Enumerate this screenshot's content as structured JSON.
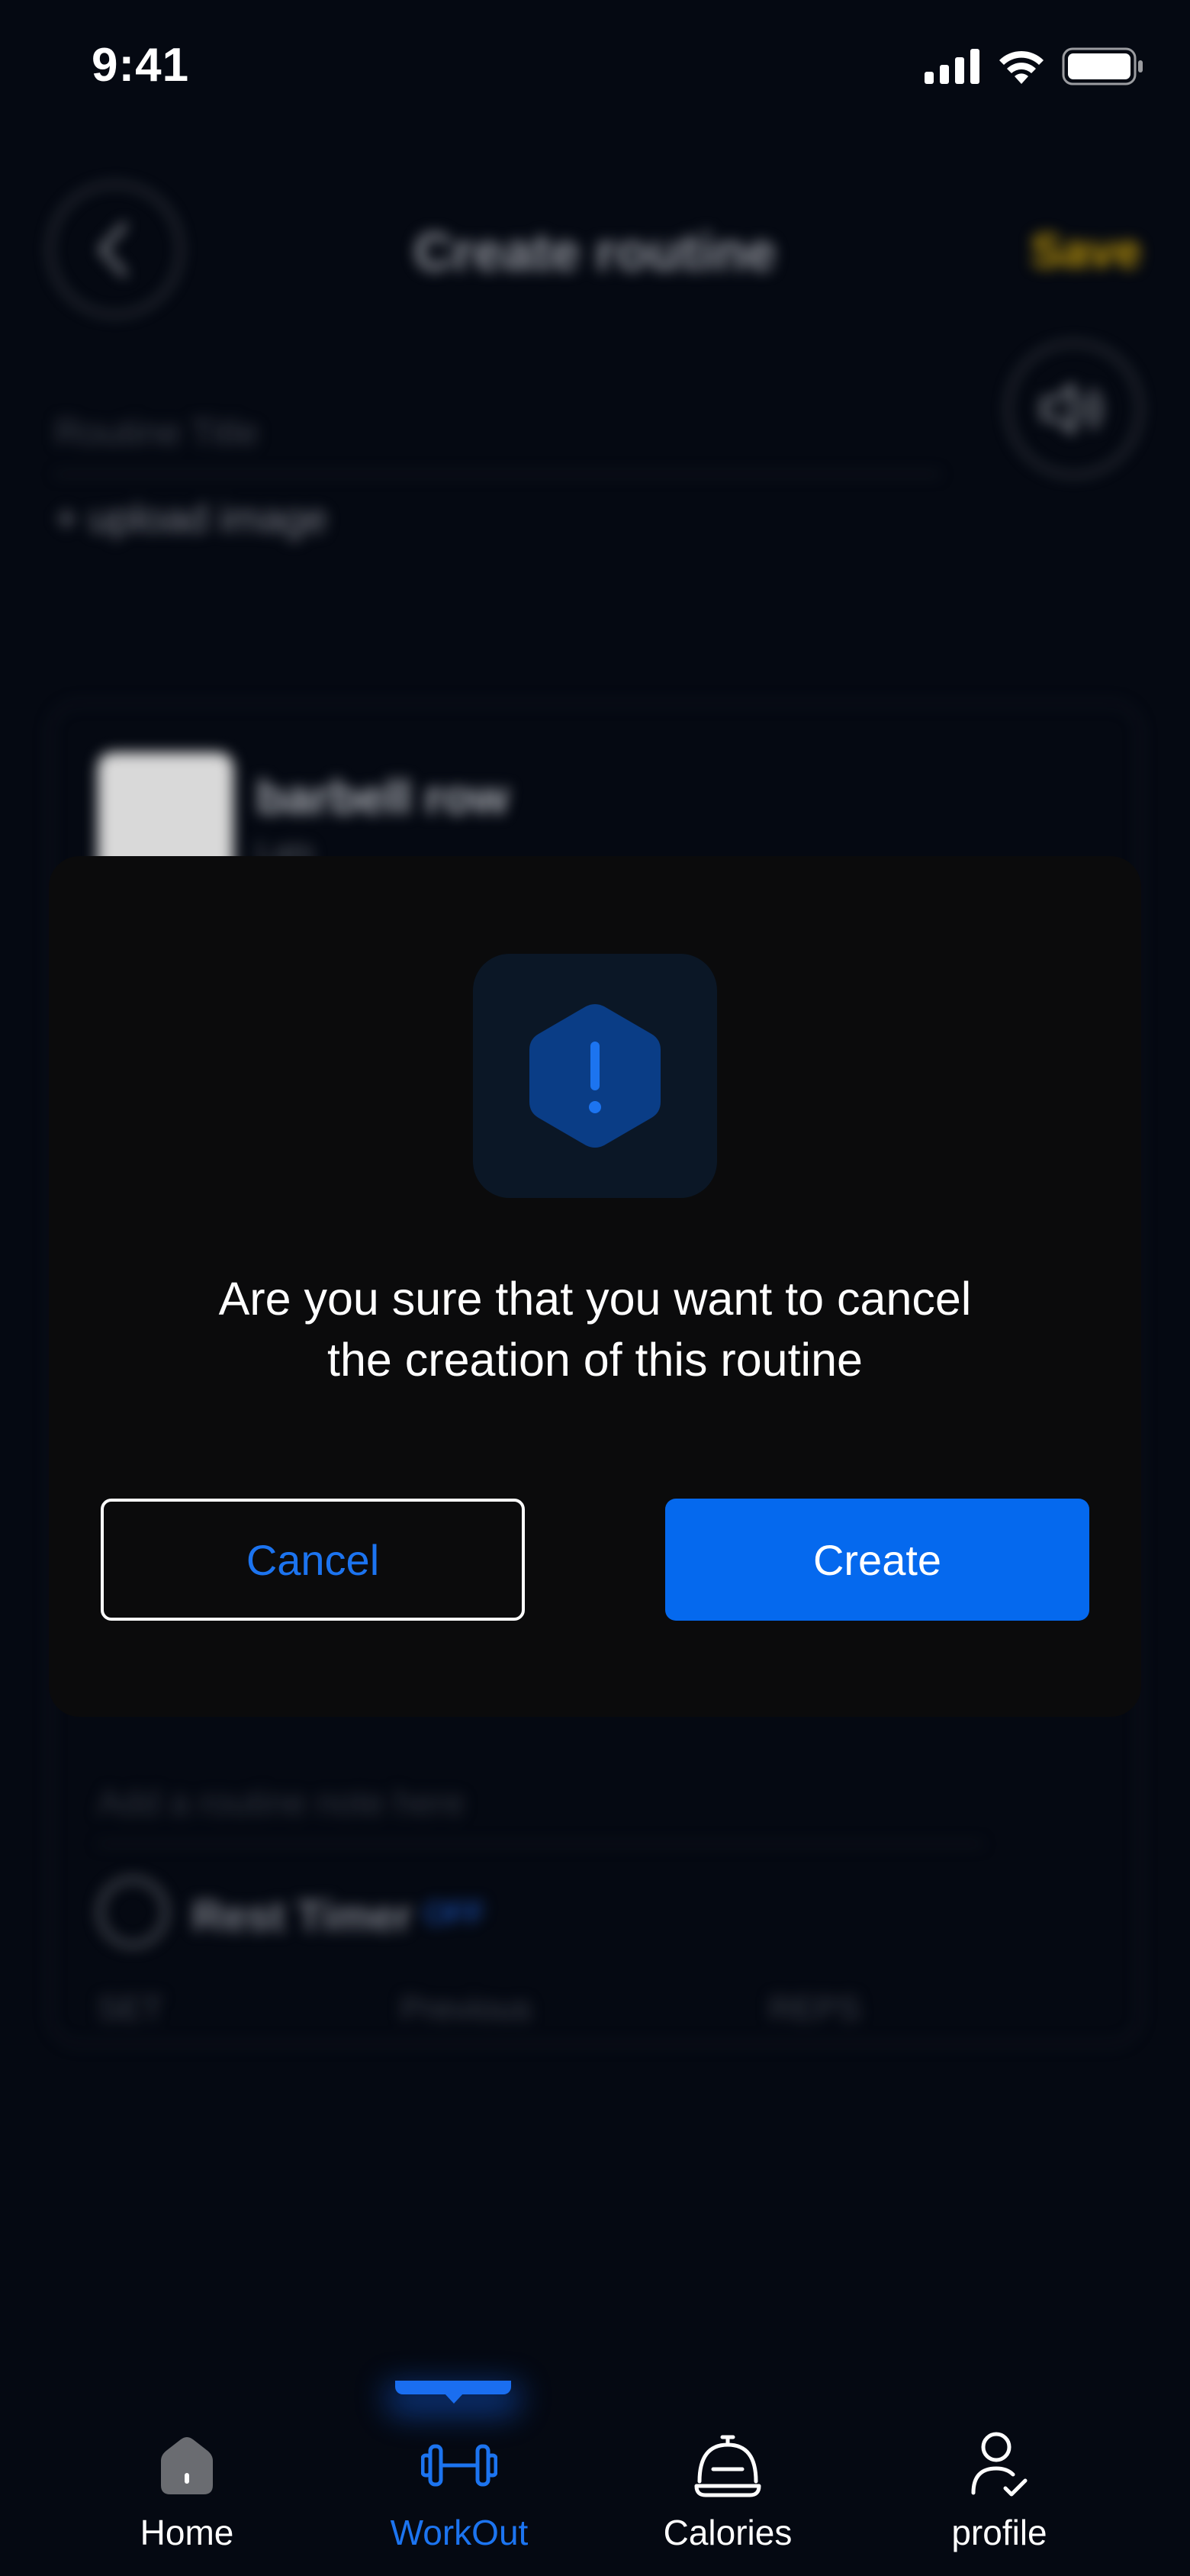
{
  "status_bar": {
    "time": "9:41",
    "icons": [
      "cellular-signal-icon",
      "wifi-icon",
      "battery-icon"
    ]
  },
  "background": {
    "header_title": "Create routine",
    "save_label": "Save",
    "routine_title_placeholder": "Routine Title",
    "upload_image_label": "+ upload image",
    "exercise": {
      "name": "barbell row",
      "subtitle": "Lats"
    },
    "note_placeholder": "Add a routine note here",
    "rest_timer": {
      "label": "Rest Timer",
      "value": "OFF"
    },
    "columns": [
      "SET",
      "Previous",
      "REPS"
    ]
  },
  "modal": {
    "icon": "alert-hexagon-icon",
    "message_line1": "Are you sure that you want to cancel",
    "message_line2": "the creation of this routine",
    "cancel_label": "Cancel",
    "create_label": "Create"
  },
  "bottom_nav": {
    "active": "WorkOut",
    "items": [
      {
        "label": "Home",
        "icon": "home-icon"
      },
      {
        "label": "WorkOut",
        "icon": "dumbbell-icon"
      },
      {
        "label": "Calories",
        "icon": "cloche-icon"
      },
      {
        "label": "profile",
        "icon": "profile-icon"
      }
    ]
  },
  "colors": {
    "background": "#050912",
    "modal": "#0b0b0c",
    "accent": "#0569ee",
    "save": "#b8920a"
  }
}
